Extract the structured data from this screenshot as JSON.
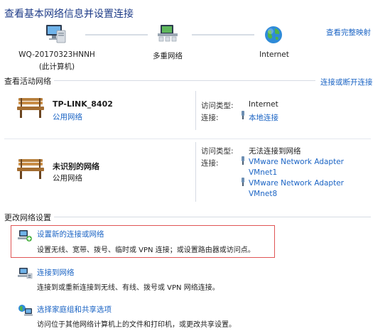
{
  "header": {
    "title": "查看基本网络信息并设置连接",
    "full_map_link": "查看完整映射"
  },
  "network_map": {
    "computer_name": "WQ-20170323HNNH",
    "computer_sub": "(此计算机)",
    "middle_label": "多重网络",
    "internet_label": "Internet"
  },
  "active_networks": {
    "title": "查看活动网络",
    "connect_link": "连接或断开连接",
    "items": [
      {
        "name": "TP-LINK_8402",
        "type": "公用网络",
        "access_label": "访问类型:",
        "access_value": "Internet",
        "conn_label": "连接:",
        "connections": [
          "本地连接"
        ]
      },
      {
        "name": "未识别的网络",
        "type": "公用网络",
        "access_label": "访问类型:",
        "access_value": "无法连接到网络",
        "conn_label": "连接:",
        "connections": [
          "VMware Network Adapter",
          "VMnet1",
          "VMware Network Adapter",
          "VMnet8"
        ]
      }
    ]
  },
  "settings": {
    "title": "更改网络设置",
    "items": [
      {
        "link": "设置新的连接或网络",
        "desc": "设置无线、宽带、拨号、临时或 VPN 连接；或设置路由器或访问点。"
      },
      {
        "link": "连接到网络",
        "desc": "连接到或重新连接到无线、有线、拨号或 VPN 网络连接。"
      },
      {
        "link": "选择家庭组和共享选项",
        "desc": "访问位于其他网络计算机上的文件和打印机，或更改共享设置。"
      }
    ]
  },
  "colors": {
    "link": "#1b64c4",
    "highlight": "#e05555"
  }
}
